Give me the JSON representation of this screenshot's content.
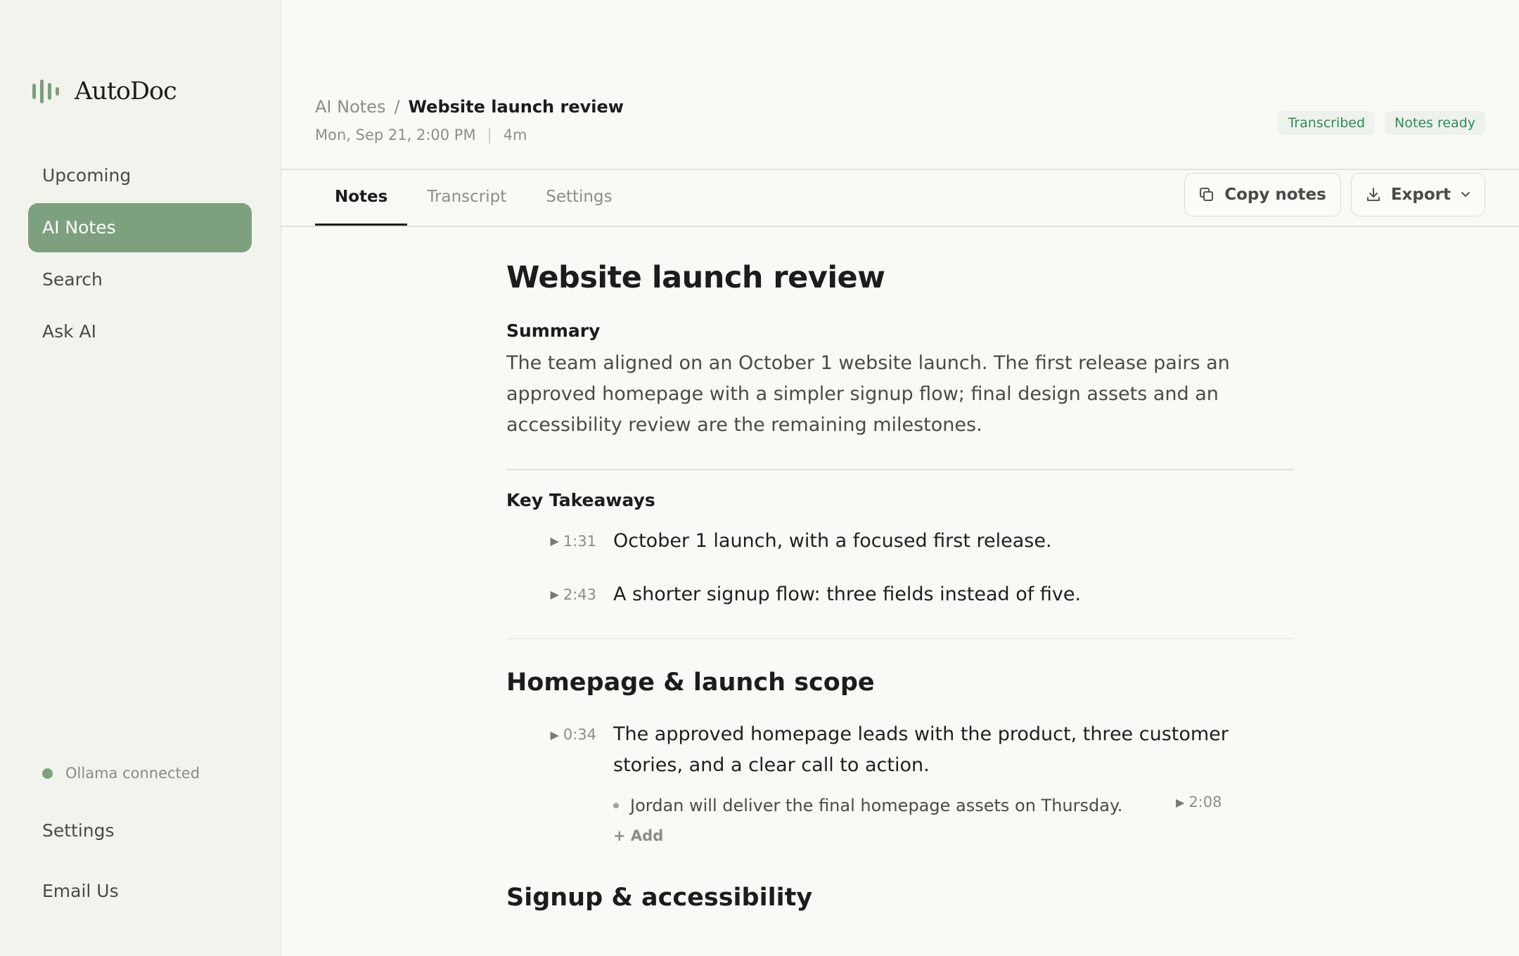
{
  "app": {
    "name": "AutoDoc"
  },
  "sidebar": {
    "items": [
      {
        "label": "Upcoming"
      },
      {
        "label": "AI Notes"
      },
      {
        "label": "Search"
      },
      {
        "label": "Ask AI"
      }
    ],
    "status": "Ollama connected",
    "settings": "Settings",
    "email": "Email Us"
  },
  "header": {
    "breadcrumb_parent": "AI Notes",
    "breadcrumb_sep": "/",
    "breadcrumb_current": "Website launch review",
    "date": "Mon, Sep 21, 2:00 PM",
    "duration": "4m",
    "badges": [
      "Transcribed",
      "Notes ready"
    ]
  },
  "tabs": [
    {
      "label": "Notes"
    },
    {
      "label": "Transcript"
    },
    {
      "label": "Settings"
    }
  ],
  "toolbar": {
    "copy_label": "Copy notes",
    "export_label": "Export"
  },
  "note": {
    "title": "Website launch review",
    "summary_label": "Summary",
    "summary": "The team aligned on an October 1 website launch. The first release pairs an approved homepage with a simpler signup flow; final design assets and an accessibility review are the remaining milestones.",
    "takeaways_label": "Key Takeaways",
    "takeaways": [
      {
        "time": "1:31",
        "text": "October 1 launch, with a focused first release."
      },
      {
        "time": "2:43",
        "text": "A shorter signup flow: three fields instead of five."
      }
    ],
    "section1": {
      "heading": "Homepage & launch scope",
      "time": "0:34",
      "text_line1": "The approved homepage leads with the product, three customer",
      "text_line2": "stories, and a clear call to action.",
      "bullet": "Jordan will deliver the final homepage assets on Thursday.",
      "bullet_time": "2:08",
      "add": "+ Add"
    },
    "section2": {
      "heading": "Signup & accessibility"
    }
  },
  "colors": {
    "accent": "#7da07f",
    "badge_text": "#2f8a55",
    "badge_bg": "#edf2ec",
    "background": "#f9f9f5"
  }
}
